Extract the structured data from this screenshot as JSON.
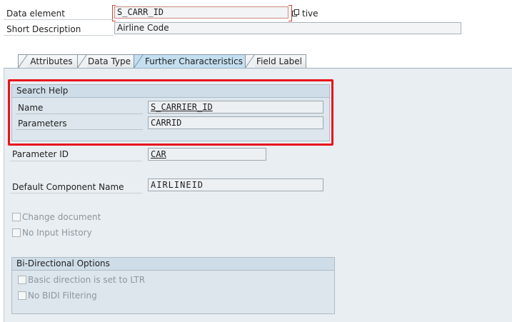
{
  "header": {
    "data_element_label": "Data element",
    "data_element_value": "S_CARR_ID",
    "status_suffix": "tive",
    "short_description_label": "Short Description",
    "short_description_value": "Airline Code"
  },
  "tabs": [
    {
      "label": "Attributes",
      "active": false
    },
    {
      "label": "Data Type",
      "active": false
    },
    {
      "label": "Further Characteristics",
      "active": true
    },
    {
      "label": "Field Label",
      "active": false
    }
  ],
  "search_help": {
    "title": "Search Help",
    "name_label": "Name",
    "name_value": "S_CARRIER_ID",
    "parameters_label": "Parameters",
    "parameters_value": "CARRID"
  },
  "parameter_id": {
    "label": "Parameter ID",
    "value": "CAR"
  },
  "default_component": {
    "label": "Default Component Name",
    "value": "AIRLINEID"
  },
  "checkboxes": {
    "change_document": {
      "label": "Change document",
      "checked": false
    },
    "no_input_history": {
      "label": "No Input History",
      "checked": false
    }
  },
  "bidi": {
    "title": "Bi-Directional Options",
    "basic_direction": {
      "label": "Basic direction is set to LTR",
      "checked": false
    },
    "no_bidi_filtering": {
      "label": "No BIDI Filtering",
      "checked": false
    }
  },
  "colors": {
    "highlight": "#e8121c",
    "active_tab": "#c4dff0",
    "panel": "#e9eef2"
  }
}
